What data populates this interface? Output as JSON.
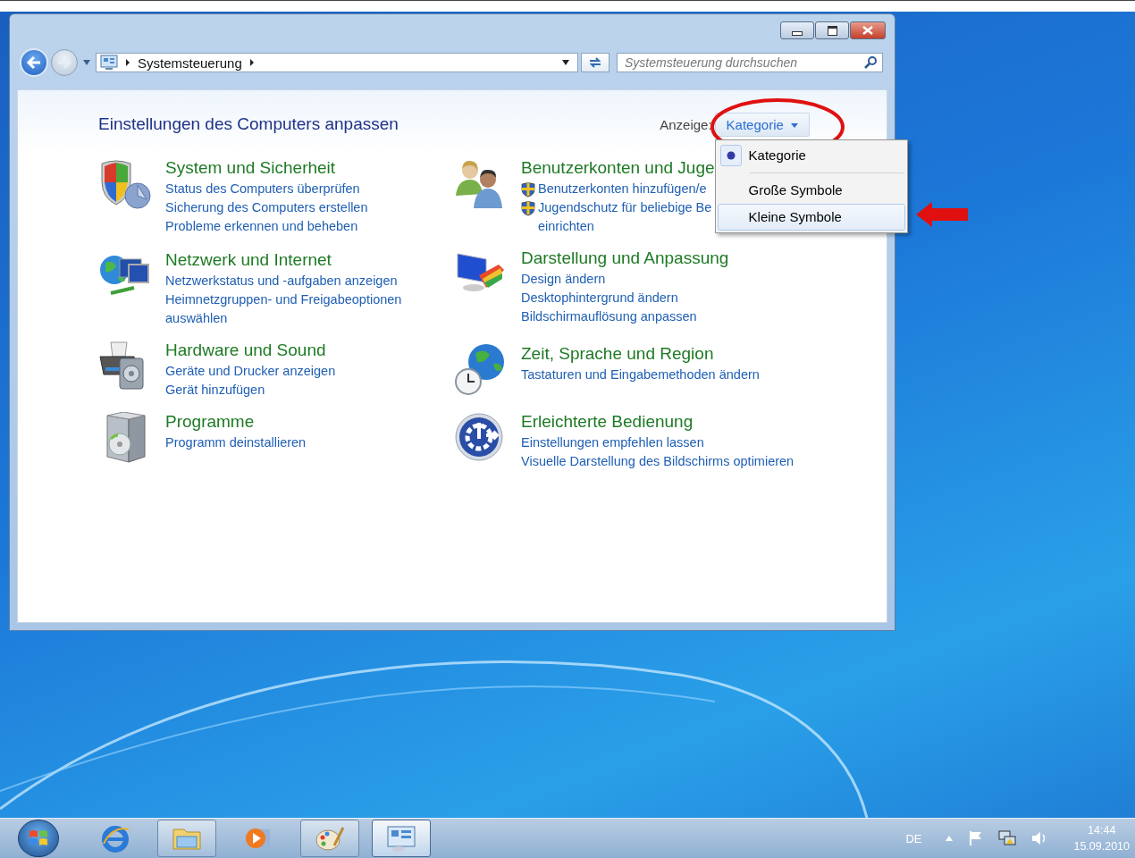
{
  "address_bar": {
    "breadcrumb": "Systemsteuerung"
  },
  "search": {
    "placeholder": "Systemsteuerung durchsuchen"
  },
  "header": {
    "title": "Einstellungen des Computers anpassen",
    "view_label": "Anzeige:",
    "view_value": "Kategorie"
  },
  "view_menu": [
    {
      "label": "Kategorie",
      "selected": true,
      "highlighted": false
    },
    {
      "label": "Große Symbole",
      "selected": false,
      "highlighted": false
    },
    {
      "label": "Kleine Symbole",
      "selected": false,
      "highlighted": true
    }
  ],
  "columns": [
    {
      "categories": [
        {
          "title": "System und Sicherheit",
          "links": [
            {
              "text": "Status des Computers überprüfen",
              "shield": false
            },
            {
              "text": "Sicherung des Computers erstellen",
              "shield": false
            },
            {
              "text": "Probleme erkennen und beheben",
              "shield": false
            }
          ]
        },
        {
          "title": "Netzwerk und Internet",
          "links": [
            {
              "text": "Netzwerkstatus und -aufgaben anzeigen",
              "shield": false
            },
            {
              "text": "Heimnetzgruppen- und Freigabeoptionen auswählen",
              "shield": false
            }
          ]
        },
        {
          "title": "Hardware und Sound",
          "links": [
            {
              "text": "Geräte und Drucker anzeigen",
              "shield": false
            },
            {
              "text": "Gerät hinzufügen",
              "shield": false
            }
          ]
        },
        {
          "title": "Programme",
          "links": [
            {
              "text": "Programm deinstallieren",
              "shield": false
            }
          ]
        }
      ]
    },
    {
      "categories": [
        {
          "title": "Benutzerkonten und Juge",
          "links": [
            {
              "text": "Benutzerkonten hinzufügen/e",
              "shield": true
            },
            {
              "text": "Jugendschutz für beliebige Be",
              "shield": true,
              "wrap": "einrichten"
            }
          ]
        },
        {
          "title": "Darstellung und Anpassung",
          "links": [
            {
              "text": "Design ändern",
              "shield": false
            },
            {
              "text": "Desktophintergrund ändern",
              "shield": false
            },
            {
              "text": "Bildschirmauflösung anpassen",
              "shield": false
            }
          ]
        },
        {
          "title": "Zeit, Sprache und Region",
          "links": [
            {
              "text": "Tastaturen und Eingabemethoden ändern",
              "shield": false
            }
          ]
        },
        {
          "title": "Erleichterte Bedienung",
          "links": [
            {
              "text": "Einstellungen empfehlen lassen",
              "shield": false
            },
            {
              "text": "Visuelle Darstellung des Bildschirms optimieren",
              "shield": false
            }
          ]
        }
      ]
    }
  ],
  "taskbar": {
    "items": [
      {
        "running": false,
        "selected": false
      },
      {
        "running": true,
        "selected": false
      },
      {
        "running": false,
        "selected": false
      },
      {
        "running": true,
        "selected": false
      },
      {
        "running": true,
        "selected": true
      }
    ]
  },
  "tray": {
    "language": "DE",
    "time": "14:44",
    "date": "15.09.2010"
  }
}
